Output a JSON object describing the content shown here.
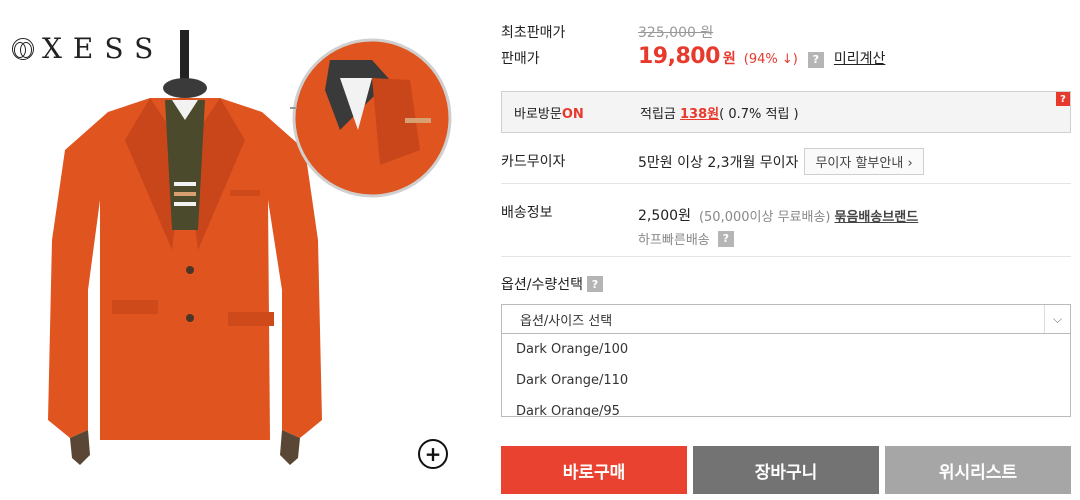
{
  "brand": {
    "name": "XESS"
  },
  "price": {
    "original_label": "최초판매가",
    "original_value": "325,000 원",
    "sale_label": "판매가",
    "sale_value": "19,800",
    "sale_unit": "원",
    "discount": "(94% ↓)",
    "help_icon": "?",
    "pre_calc_label": "미리계산"
  },
  "visit": {
    "label_prefix": "바로방문",
    "label_on": "ON",
    "points_prefix": "적립금 ",
    "points_amount": "138원",
    "points_suffix": "( 0.7% 적립 )",
    "badge": "?"
  },
  "card": {
    "label": "카드무이자",
    "value": "5만원 이상 2,3개월 무이자",
    "button": "무이자 할부안내 ›"
  },
  "shipping": {
    "label": "배송정보",
    "fee": "2,500원",
    "condition": "(50,000이상 무료배송)",
    "bundle_link": "묶음배송브랜드",
    "fast_label": "하프빠른배송",
    "help_icon": "?"
  },
  "options": {
    "label": "옵션/수량선택",
    "help_icon": "?",
    "select_placeholder": "옵션/사이즈 선택",
    "items": [
      "Dark Orange/100",
      "Dark Orange/110",
      "Dark Orange/95"
    ]
  },
  "buttons": {
    "buy": "바로구매",
    "cart": "장바구니",
    "wishlist": "위시리스트"
  },
  "colors": {
    "accent": "#e8392d",
    "jacket": "#e0541f",
    "cart": "#737373",
    "wishlist": "#a6a6a6"
  }
}
